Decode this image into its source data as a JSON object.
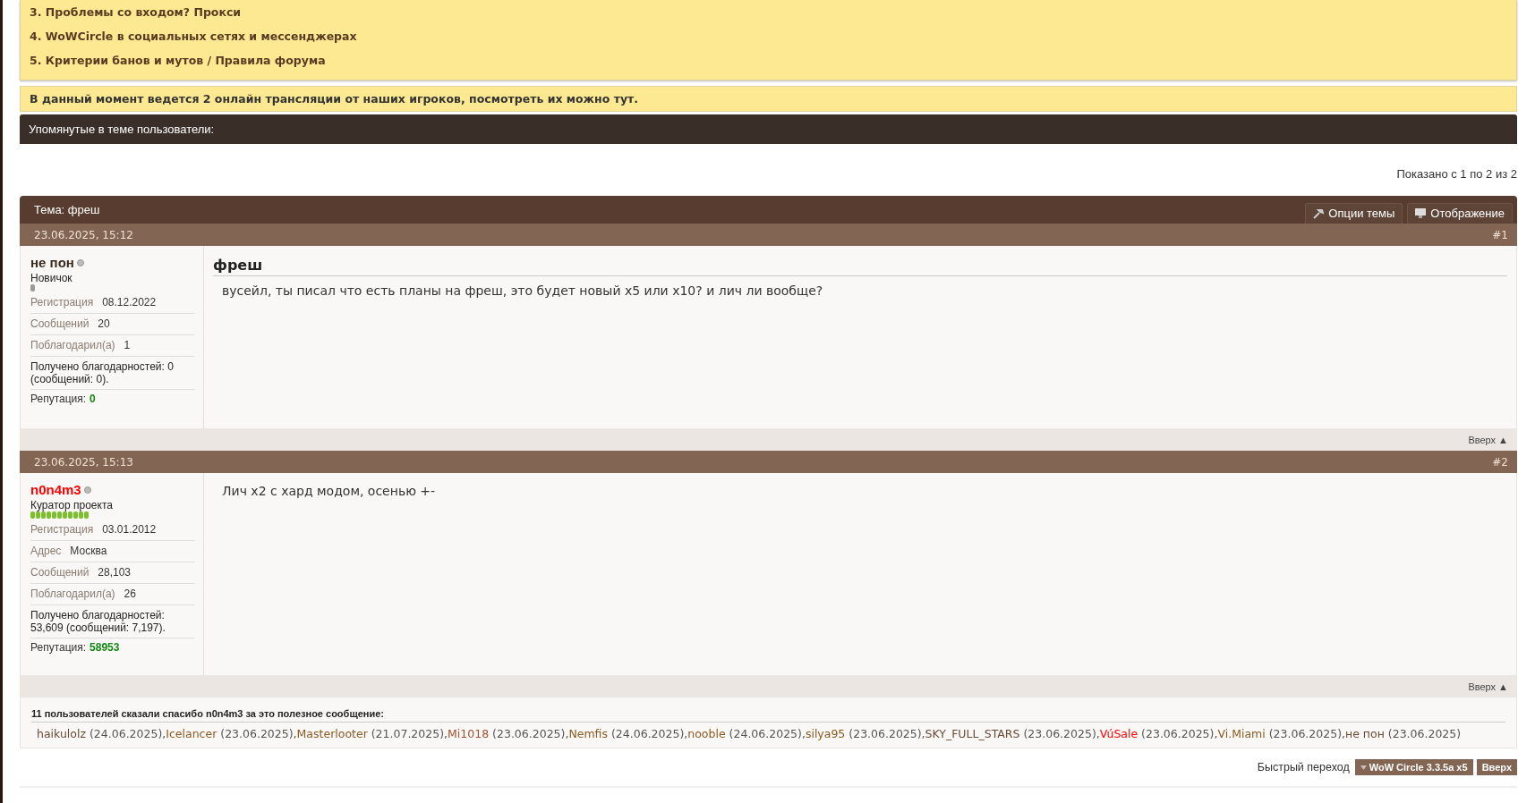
{
  "notices": {
    "items": [
      "3. Проблемы со входом? Прокси",
      "4. WoWCircle в социальных сетях и мессенджерах",
      "5. Критерии банов и мутов / Правила форума"
    ]
  },
  "stream_notice": "В данный момент ведется 2 онлайн трансляции от наших игроков, посмотреть их можно тут.",
  "mentioned_bar": "Упомянутые в теме пользователи:",
  "pagination": "Показано с 1 по 2 из 2",
  "thread": {
    "title": "Тема: фреш",
    "buttons": [
      {
        "label": "Опции темы",
        "kind": "tools"
      },
      {
        "label": "Отображение",
        "kind": "display"
      }
    ]
  },
  "posts": [
    {
      "date": "23.06.2025, 15:12",
      "number": "#1",
      "username": "не пон",
      "color": "#3b2a1e",
      "rank": "Новичок",
      "rank_bar": {
        "kind": "single_grey"
      },
      "fields": [
        {
          "label": "Регистрация",
          "value": "08.12.2022"
        },
        {
          "label": "Сообщений",
          "value": "20"
        },
        {
          "label": "Поблагодарил(а)",
          "value": "1"
        }
      ],
      "thanks_received": "Получено благодарностей: 0 (сообщений: 0).",
      "reputation_label": "Репутация:",
      "reputation": "0",
      "title": "фреш",
      "message": "вусейл, ты писал что есть планы на фреш, это будет новый х5 или х10? и лич ли вообще?",
      "top_link": "Вверх ▲"
    },
    {
      "date": "23.06.2025, 15:13",
      "number": "#2",
      "username": "n0n4m3",
      "color": "#ff0000",
      "rank": "Куратор проекта",
      "rank_bar": {
        "kind": "full_green"
      },
      "fields": [
        {
          "label": "Регистрация",
          "value": "03.01.2012"
        },
        {
          "label": "Адрес",
          "value": "Москва"
        },
        {
          "label": "Сообщений",
          "value": "28,103"
        },
        {
          "label": "Поблагодарил(а)",
          "value": "26"
        }
      ],
      "thanks_received": "Получено благодарностей: 53,609 (сообщений: 7,197).",
      "reputation_label": "Репутация:",
      "reputation": "58953",
      "message": "Лич х2 с хард модом, осенью +-",
      "top_link": "Вверх ▲"
    }
  ],
  "thanks": {
    "heading": "11 пользователей сказали спасибо n0n4m3 за это полезное сообщение:",
    "names": [
      {
        "name": "haikulolz",
        "date": " (24.06.2025),",
        "color": "#6b4a35"
      },
      {
        "name": "Icelancer",
        "date": " (23.06.2025),",
        "color": "#8a5a1e"
      },
      {
        "name": "Masterlooter",
        "date": " (21.07.2025),",
        "color": "#8a5a1e"
      },
      {
        "name": "Mi1018",
        "date": " (23.06.2025),",
        "color": "#a0522d"
      },
      {
        "name": "Nemfis",
        "date": " (24.06.2025),",
        "color": "#8a5a1e"
      },
      {
        "name": "nooble",
        "date": " (24.06.2025),",
        "color": "#8a5a1e"
      },
      {
        "name": "silya95",
        "date": " (23.06.2025),",
        "color": "#8a5a1e"
      },
      {
        "name": "SKY_FULL_STARS",
        "date": " (23.06.2025),",
        "color": "#6b4a35"
      },
      {
        "name": "VúSale",
        "date": " (23.06.2025),",
        "color": "#ff0000"
      },
      {
        "name": "Vi.Miami",
        "date": " (23.06.2025),",
        "color": "#8a5a1e"
      },
      {
        "name": "не пон",
        "date": " (23.06.2025)",
        "color": "#6b4a35"
      }
    ]
  },
  "footer": {
    "quick_nav_label": "Быстрый переход",
    "forum_select": "WoW Circle 3.3.5a x5",
    "top_button": "Вверх"
  }
}
